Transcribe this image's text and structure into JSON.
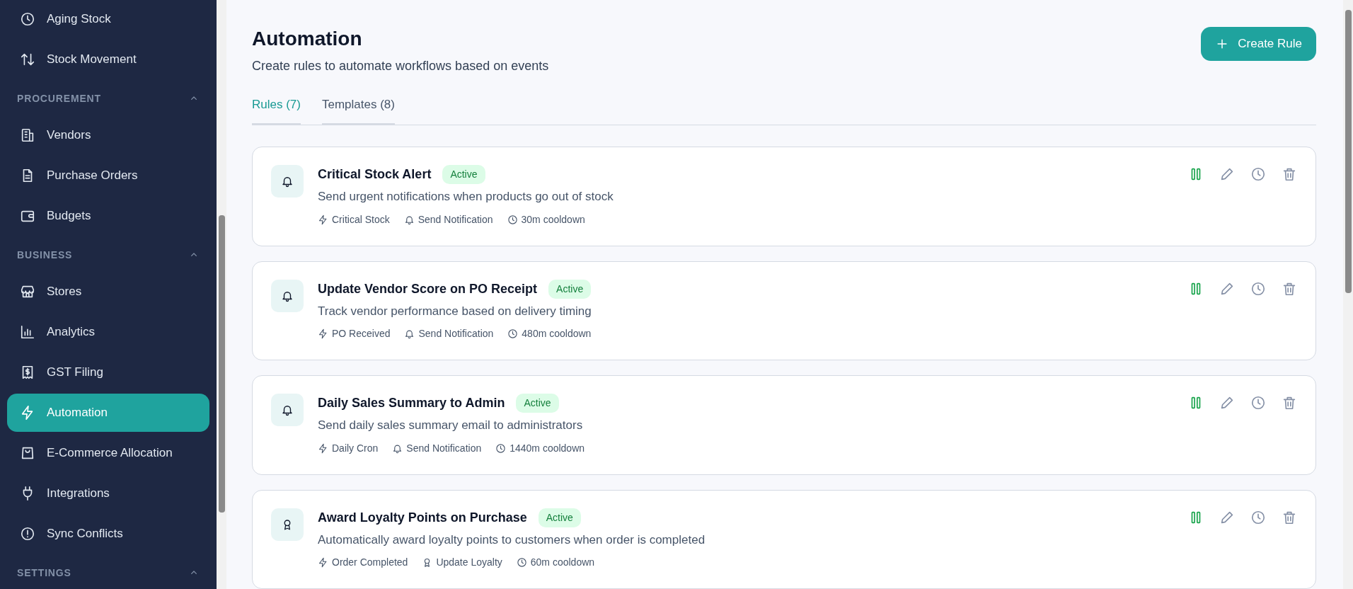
{
  "sidebar": {
    "sections": [
      {
        "items": [
          {
            "label": "Aging Stock",
            "selected": false
          },
          {
            "label": "Stock Movement",
            "selected": false
          }
        ]
      },
      {
        "header": "PROCUREMENT",
        "expanded": true,
        "items": [
          {
            "label": "Vendors",
            "selected": false
          },
          {
            "label": "Purchase Orders",
            "selected": false
          },
          {
            "label": "Budgets",
            "selected": false
          }
        ]
      },
      {
        "header": "BUSINESS",
        "expanded": true,
        "items": [
          {
            "label": "Stores",
            "selected": false
          },
          {
            "label": "Analytics",
            "selected": false
          },
          {
            "label": "GST Filing",
            "selected": false
          },
          {
            "label": "Automation",
            "selected": true
          },
          {
            "label": "E-Commerce Allocation",
            "selected": false
          },
          {
            "label": "Integrations",
            "selected": false
          },
          {
            "label": "Sync Conflicts",
            "selected": false
          }
        ]
      },
      {
        "header": "SETTINGS",
        "expanded": true
      }
    ]
  },
  "page": {
    "title": "Automation",
    "subtitle": "Create rules to automate workflows based on events",
    "create_button": "Create Rule"
  },
  "tabs": [
    {
      "label": "Rules (7)",
      "selected": true
    },
    {
      "label": "Templates (8)",
      "selected": false
    }
  ],
  "rules": [
    {
      "kind": "notification",
      "name": "Critical Stock Alert",
      "status": "Active",
      "active": true,
      "description": "Send urgent notifications when products go out of stock",
      "trigger": "Critical Stock",
      "action": "Send Notification",
      "cooldown": "30m cooldown"
    },
    {
      "kind": "notification",
      "name": "Update Vendor Score on PO Receipt",
      "status": "Active",
      "active": true,
      "description": "Track vendor performance based on delivery timing",
      "trigger": "PO Received",
      "action": "Send Notification",
      "cooldown": "480m cooldown"
    },
    {
      "kind": "notification",
      "name": "Daily Sales Summary to Admin",
      "status": "Active",
      "active": true,
      "description": "Send daily sales summary email to administrators",
      "trigger": "Daily Cron",
      "action": "Send Notification",
      "cooldown": "1440m cooldown"
    },
    {
      "kind": "loyalty",
      "name": "Award Loyalty Points on Purchase",
      "status": "Active",
      "active": true,
      "description": "Automatically award loyalty points to customers when order is completed",
      "trigger": "Order Completed",
      "action": "Update Loyalty",
      "cooldown": "60m cooldown"
    }
  ]
}
